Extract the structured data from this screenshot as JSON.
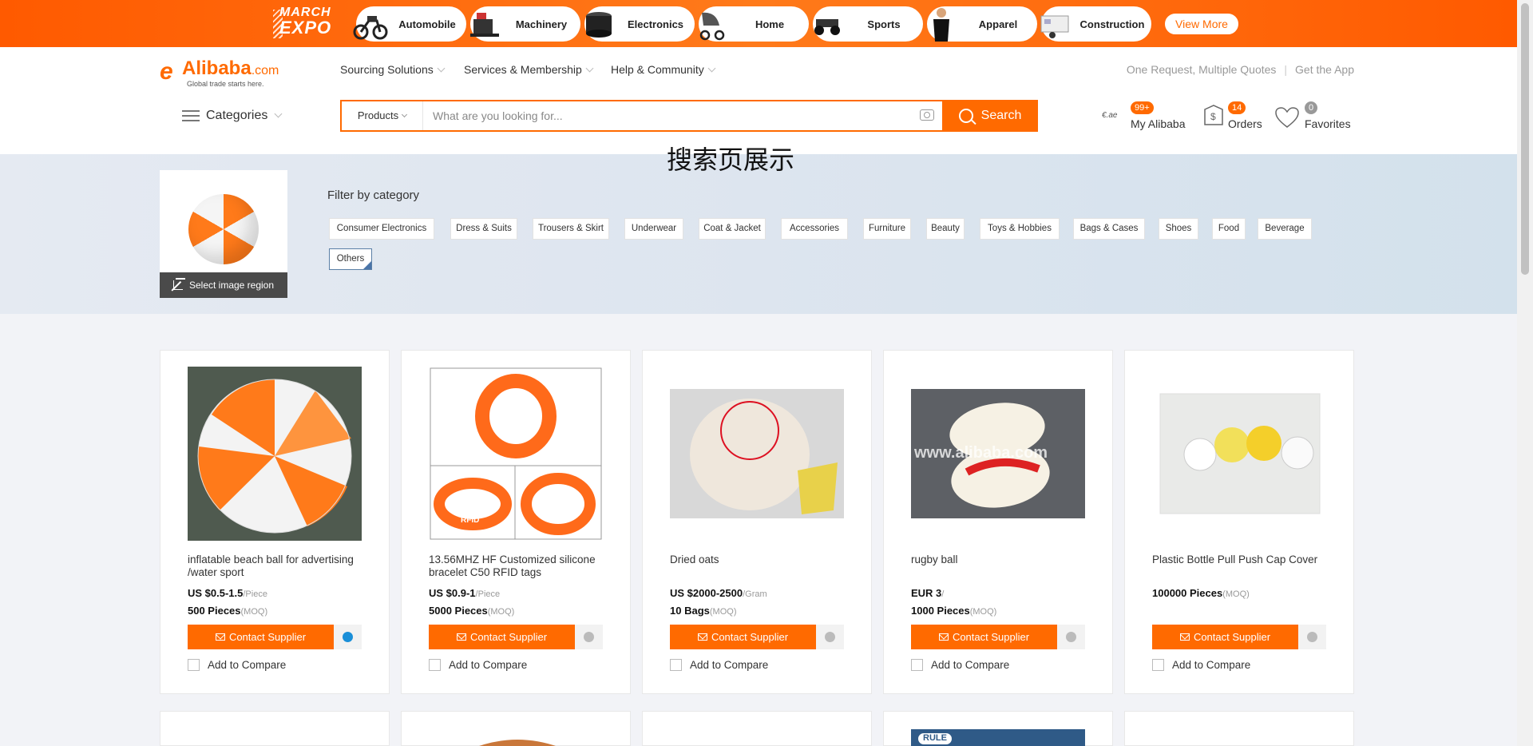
{
  "expo": {
    "logo_line1": "MARCH",
    "logo_line2": "EXPO",
    "categories": [
      "Automobile",
      "Machinery",
      "Electronics",
      "Home",
      "Sports",
      "Apparel",
      "Construction"
    ],
    "view_more": "View More"
  },
  "header": {
    "logo_mark": "e",
    "logo_word": "Alibaba",
    "logo_suffix": ".com",
    "logo_tagline": "Global trade starts here.",
    "nav": [
      "Sourcing Solutions",
      "Services & Membership",
      "Help & Community"
    ],
    "right_links": [
      "One Request, Multiple Quotes",
      "Get the App"
    ],
    "categories_label": "Categories",
    "search": {
      "type": "Products",
      "placeholder": "What are you looking for...",
      "button": "Search"
    },
    "my_alibaba": {
      "label": "My Alibaba",
      "badge": "99+"
    },
    "orders": {
      "label": "Orders",
      "badge": "14"
    },
    "favorites": {
      "label": "Favorites",
      "badge": "0"
    }
  },
  "page_caption": "搜索页展示",
  "filter": {
    "select_region": "Select image region",
    "title": "Filter by category",
    "categories": [
      "Consumer Electronics",
      "Dress & Suits",
      "Trousers & Skirt",
      "Underwear",
      "Coat & Jacket",
      "Accessories",
      "Furniture",
      "Beauty",
      "Toys & Hobbies",
      "Bags & Cases",
      "Shoes",
      "Food",
      "Beverage",
      "Others"
    ],
    "selected": "Others"
  },
  "products": [
    {
      "title": "inflatable beach ball for advertising /water sport",
      "price": "US $0.5-1.5",
      "price_unit": "/Piece",
      "moq": "500 Pieces",
      "moq_unit": "(MOQ)",
      "contact": "Contact Supplier",
      "compare": "Add to Compare",
      "online": true
    },
    {
      "title": "13.56MHZ HF Customized silicone bracelet C50 RFID tags",
      "price": "US $0.9-1",
      "price_unit": "/Piece",
      "moq": "5000 Pieces",
      "moq_unit": "(MOQ)",
      "contact": "Contact Supplier",
      "compare": "Add to Compare",
      "online": false
    },
    {
      "title": "Dried oats",
      "price": "US $2000-2500",
      "price_unit": "/Gram",
      "moq": "10 Bags",
      "moq_unit": "(MOQ)",
      "contact": "Contact Supplier",
      "compare": "Add to Compare",
      "online": false
    },
    {
      "title": "rugby ball",
      "price": "EUR 3",
      "price_unit": "/",
      "moq": "1000 Pieces",
      "moq_unit": "(MOQ)",
      "contact": "Contact Supplier",
      "compare": "Add to Compare",
      "online": false
    },
    {
      "title": "Plastic Bottle Pull Push Cap Cover",
      "price": "100000 Pieces",
      "price_unit": "(MOQ)",
      "moq": "",
      "moq_unit": "",
      "contact": "Contact Supplier",
      "compare": "Add to Compare",
      "online": false
    }
  ],
  "image_text": {
    "rfid": "RFID",
    "watermark": "www.alibaba.com",
    "rule": "RULE"
  },
  "colors": {
    "brand": "#ff6a00",
    "online": "#1a8fd8"
  }
}
